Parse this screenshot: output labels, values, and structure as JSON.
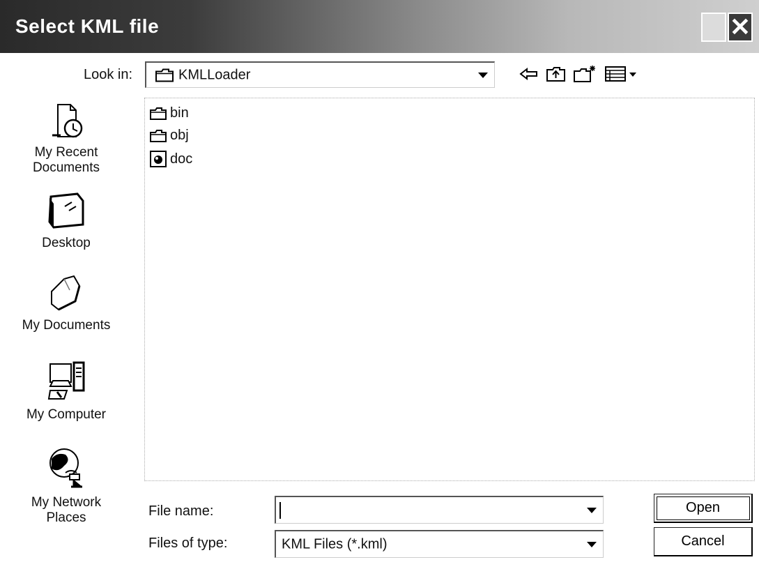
{
  "dialog": {
    "title": "Select KML file"
  },
  "look_in": {
    "label": "Look in:",
    "value": "KMLLoader"
  },
  "places": [
    {
      "label_line1": "My Recent",
      "label_line2": "Documents",
      "icon": "recent-documents-icon"
    },
    {
      "label_line1": "Desktop",
      "label_line2": "",
      "icon": "desktop-icon"
    },
    {
      "label_line1": "My Documents",
      "label_line2": "",
      "icon": "my-documents-icon"
    },
    {
      "label_line1": "My Computer",
      "label_line2": "",
      "icon": "my-computer-icon"
    },
    {
      "label_line1": "My Network",
      "label_line2": "Places",
      "icon": "network-places-icon"
    }
  ],
  "files": [
    {
      "name": "bin",
      "icon": "folder-icon"
    },
    {
      "name": "obj",
      "icon": "folder-icon"
    },
    {
      "name": "doc",
      "icon": "document-icon"
    }
  ],
  "file_name": {
    "label": "File name:",
    "value": ""
  },
  "file_type": {
    "label": "Files of type:",
    "value": "KML Files (*.kml)"
  },
  "buttons": {
    "open": "Open",
    "cancel": "Cancel"
  }
}
